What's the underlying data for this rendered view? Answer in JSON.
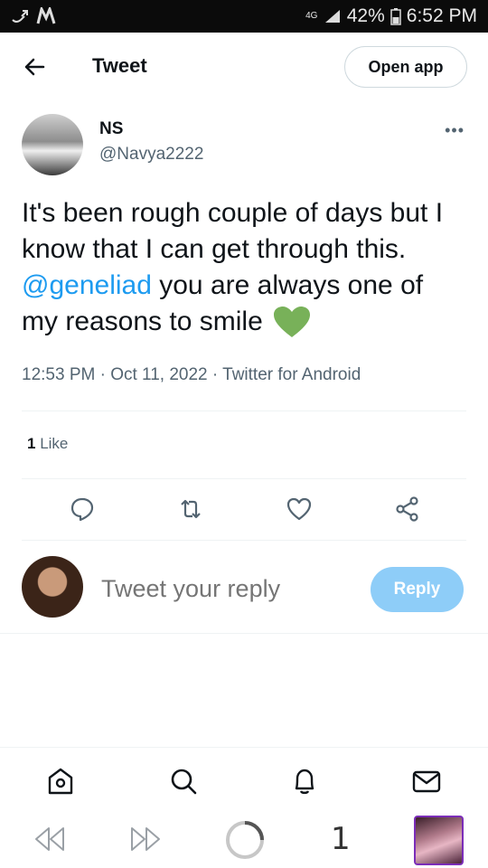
{
  "status_bar": {
    "network": "4G",
    "battery": "42%",
    "time": "6:52 PM"
  },
  "header": {
    "title": "Tweet",
    "open_app_label": "Open app"
  },
  "tweet": {
    "author_name": "NS",
    "author_handle": "@Navya2222",
    "text_before_mention": "It's been rough couple of days but I know that I can get through this. ",
    "mention": "@geneliad",
    "text_after_mention": " you are always one of my reasons to smile ",
    "emoji": "green-heart",
    "meta": "12:53 PM · Oct 11, 2022 · Twitter for Android",
    "like_count": "1",
    "like_label": "Like"
  },
  "reply": {
    "placeholder": "Tweet your reply",
    "button_label": "Reply"
  },
  "bottom_nav": {
    "icons": [
      "home-icon",
      "search-icon",
      "notifications-icon",
      "messages-icon"
    ]
  },
  "system_bar": {
    "tab_count": "1"
  },
  "colors": {
    "accent": "#1d9bf0",
    "reply_button": "#8ecdf8",
    "secondary_text": "#536471",
    "heart": "#78b159"
  }
}
